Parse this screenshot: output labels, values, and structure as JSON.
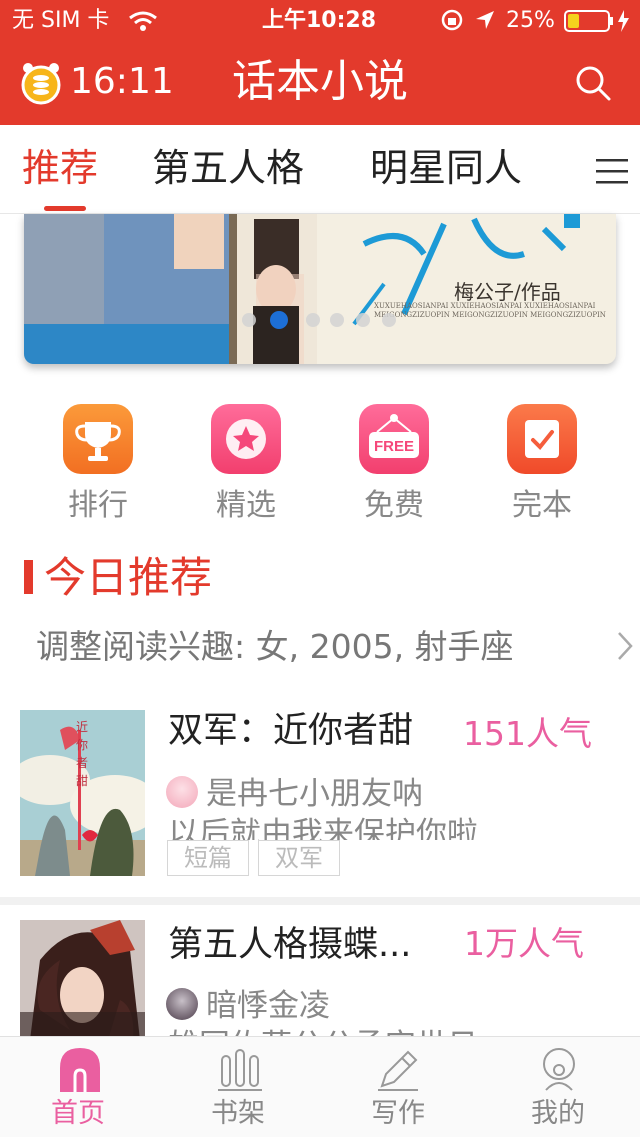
{
  "status_bar": {
    "carrier": "无 SIM 卡",
    "time": "上午10:28",
    "battery": "25%"
  },
  "header": {
    "countdown": "16:11",
    "title": "话本小说"
  },
  "tabs": [
    {
      "label": "推荐",
      "active": true
    },
    {
      "label": "第五人格",
      "active": false
    },
    {
      "label": "明星同人",
      "active": false
    }
  ],
  "banner": {
    "caption": "梅公子/作品",
    "pinyin": "XUXUEHAOSIANPAI XUXIEHAOSIANPAI XUXIEHAOSIANPAI",
    "pinyin2": "MEIGONGZIZUOPIN MEIGONGZIZUOPIN MEIGONGZIZUOPIN",
    "page_count": 6,
    "active_page": 2
  },
  "categories": [
    {
      "label": "排行",
      "icon": "trophy-icon",
      "color": "#f77f2b"
    },
    {
      "label": "精选",
      "icon": "star-icon",
      "color": "#f5487a"
    },
    {
      "label": "免费",
      "icon": "free-tag-icon",
      "color": "#f5487a",
      "badge": "FREE"
    },
    {
      "label": "完本",
      "icon": "check-note-icon",
      "color": "#f55d3c"
    }
  ],
  "section": {
    "title": "今日推荐",
    "interest": "调整阅读兴趣: 女, 2005, 射手座"
  },
  "books": [
    {
      "title": "双军：近你者甜",
      "popularity": "151人气",
      "author": "是冉七小朋友呐",
      "description": "以后就由我来保护你啦",
      "tags": [
        "短篇",
        "双军"
      ],
      "cover_text": "近你者甜"
    },
    {
      "title": "第五人格摄蝶...",
      "popularity": "1万人气",
      "author": "暗悸金凌",
      "description": "雄国佐蒋公公丞定世日"
    }
  ],
  "tab_bar": [
    {
      "label": "首页",
      "icon": "home-icon",
      "active": true
    },
    {
      "label": "书架",
      "icon": "bookshelf-icon",
      "active": false
    },
    {
      "label": "写作",
      "icon": "pencil-icon",
      "active": false
    },
    {
      "label": "我的",
      "icon": "profile-icon",
      "active": false
    }
  ],
  "colors": {
    "brand": "#e33a2c",
    "accent_pink": "#ea5fa0",
    "muted": "#888888"
  }
}
